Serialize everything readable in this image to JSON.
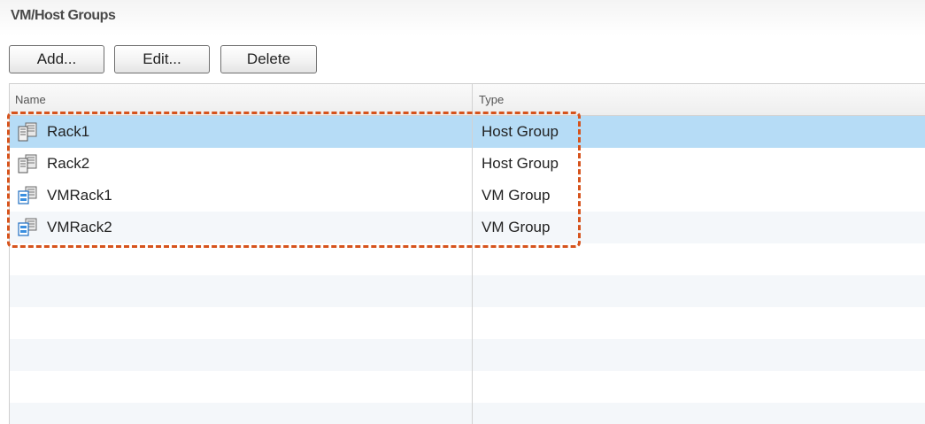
{
  "panel": {
    "title": "VM/Host Groups"
  },
  "toolbar": {
    "add_label": "Add...",
    "edit_label": "Edit...",
    "delete_label": "Delete"
  },
  "table": {
    "columns": [
      "Name",
      "Type"
    ],
    "rows": [
      {
        "name": "Rack1",
        "type": "Host Group",
        "icon": "host-group-icon",
        "selected": true
      },
      {
        "name": "Rack2",
        "type": "Host Group",
        "icon": "host-group-icon",
        "selected": false
      },
      {
        "name": "VMRack1",
        "type": "VM Group",
        "icon": "vm-group-icon",
        "selected": false
      },
      {
        "name": "VMRack2",
        "type": "VM Group",
        "icon": "vm-group-icon",
        "selected": false
      }
    ]
  },
  "colors": {
    "selected_row": "#b6dcf6",
    "alt_row": "#f4f7fa",
    "highlight_border": "#d6531c"
  }
}
